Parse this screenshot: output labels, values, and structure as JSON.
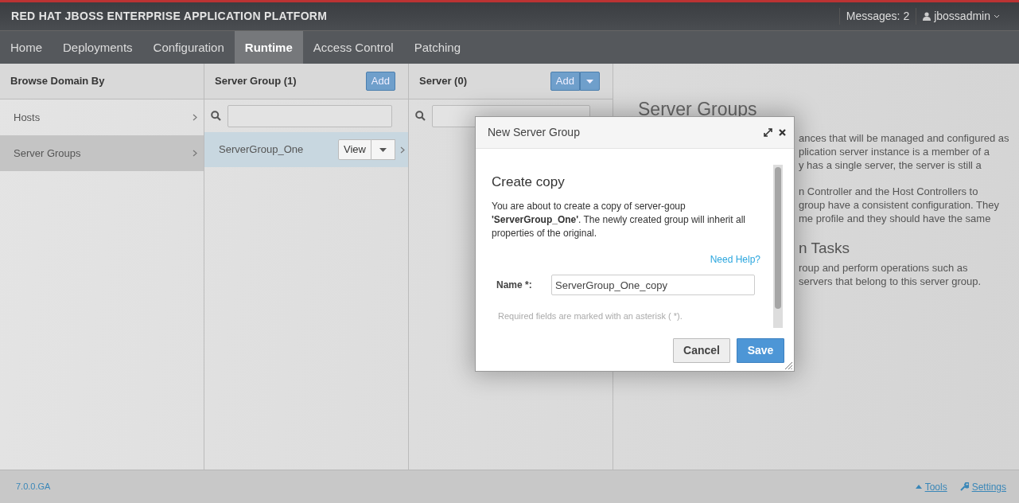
{
  "header": {
    "brand": "RED HAT JBOSS ENTERPRISE APPLICATION PLATFORM",
    "messages": "Messages: 2",
    "user": "jbossadmin"
  },
  "nav": [
    {
      "label": "Home",
      "selected": false
    },
    {
      "label": "Deployments",
      "selected": false
    },
    {
      "label": "Configuration",
      "selected": false
    },
    {
      "label": "Runtime",
      "selected": true
    },
    {
      "label": "Access Control",
      "selected": false
    },
    {
      "label": "Patching",
      "selected": false
    }
  ],
  "browse": {
    "title": "Browse Domain By",
    "items": [
      {
        "label": "Hosts",
        "selected": false
      },
      {
        "label": "Server Groups",
        "selected": true
      }
    ]
  },
  "server_group": {
    "title": "Server Group (1)",
    "add_button": "Add",
    "items": [
      {
        "label": "ServerGroup_One",
        "selected": true,
        "view_button": "View"
      }
    ]
  },
  "server": {
    "title": "Server (0)",
    "add_button": "Add"
  },
  "info": {
    "heading": "Server Groups",
    "paragraphs": [
      [
        "ances that will be managed and configured as",
        "plication server instance is a member of a",
        "y has a single server, the server is still a"
      ],
      [
        "n Controller and the Host Controllers to",
        "group have a consistent configuration. They",
        "me profile and they should have the same"
      ]
    ],
    "subheading": "n Tasks",
    "task_lines": [
      "roup and perform operations such as",
      "servers that belong to this server group."
    ]
  },
  "dialog": {
    "title": "New Server Group",
    "heading": "Create copy",
    "description": "You are about to create a copy of server-goup **'ServerGroup_One'**. The newly created group will inherit all properties of the original.",
    "help_link": "Need Help?",
    "field_label": "Name *:",
    "field_value": "ServerGroup_One_copy",
    "note": "Required fields are marked with an asterisk ( *).",
    "buttons": [
      {
        "label": "Cancel",
        "kind": "default"
      },
      {
        "label": "Save",
        "kind": "primary"
      }
    ]
  },
  "footer": {
    "version": "7.0.0.GA",
    "tools": "Tools",
    "settings": "Settings"
  }
}
